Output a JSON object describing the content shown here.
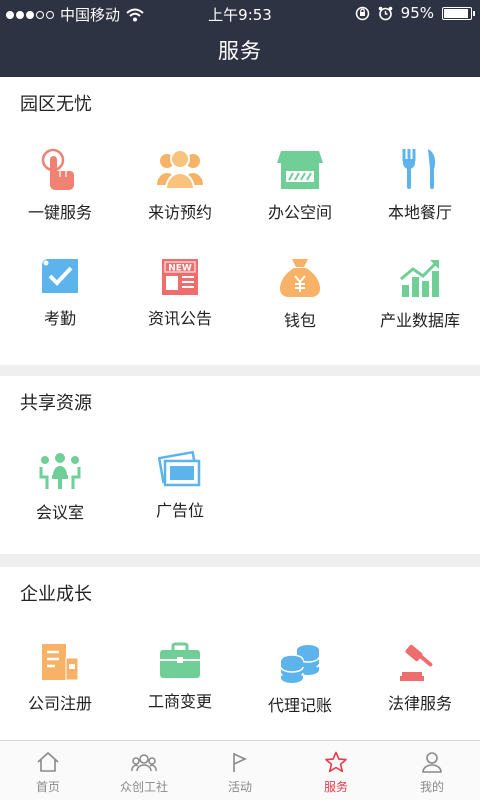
{
  "status_bar": {
    "carrier": "中国移动",
    "time": "上午9:53",
    "battery": "95%",
    "battery_level": 0.95,
    "icons": [
      "signal-dots-icon",
      "wifi-icon",
      "orientation-lock-icon",
      "alarm-icon",
      "battery-icon"
    ]
  },
  "nav": {
    "title": "服务"
  },
  "sections": [
    {
      "title": "园区无忧",
      "items": [
        {
          "label": "一键服务",
          "icon": "hand-tap-icon"
        },
        {
          "label": "来访预约",
          "icon": "visitors-icon"
        },
        {
          "label": "办公空间",
          "icon": "storefront-icon"
        },
        {
          "label": "本地餐厅",
          "icon": "fork-knife-icon"
        },
        {
          "label": "考勤",
          "icon": "checkbox-tag-icon"
        },
        {
          "label": "资讯公告",
          "icon": "news-icon"
        },
        {
          "label": "钱包",
          "icon": "money-bag-icon"
        },
        {
          "label": "产业数据库",
          "icon": "growth-chart-icon"
        }
      ]
    },
    {
      "title": "共享资源",
      "items": [
        {
          "label": "会议室",
          "icon": "meeting-room-icon"
        },
        {
          "label": "广告位",
          "icon": "ad-slot-icon"
        }
      ]
    },
    {
      "title": "企业成长",
      "items": [
        {
          "label": "公司注册",
          "icon": "building-icon"
        },
        {
          "label": "工商变更",
          "icon": "briefcase-icon"
        },
        {
          "label": "代理记账",
          "icon": "coins-icon"
        },
        {
          "label": "法律服务",
          "icon": "gavel-icon"
        }
      ]
    }
  ],
  "tabbar": [
    {
      "label": "首页",
      "icon": "home-icon"
    },
    {
      "label": "众创工社",
      "icon": "community-icon"
    },
    {
      "label": "活动",
      "icon": "flag-icon"
    },
    {
      "label": "服务",
      "icon": "star-icon",
      "active": true
    },
    {
      "label": "我的",
      "icon": "user-icon"
    }
  ],
  "colors": {
    "header": "#2e3344",
    "active_tab": "#e63b4a",
    "background": "#efefef"
  }
}
